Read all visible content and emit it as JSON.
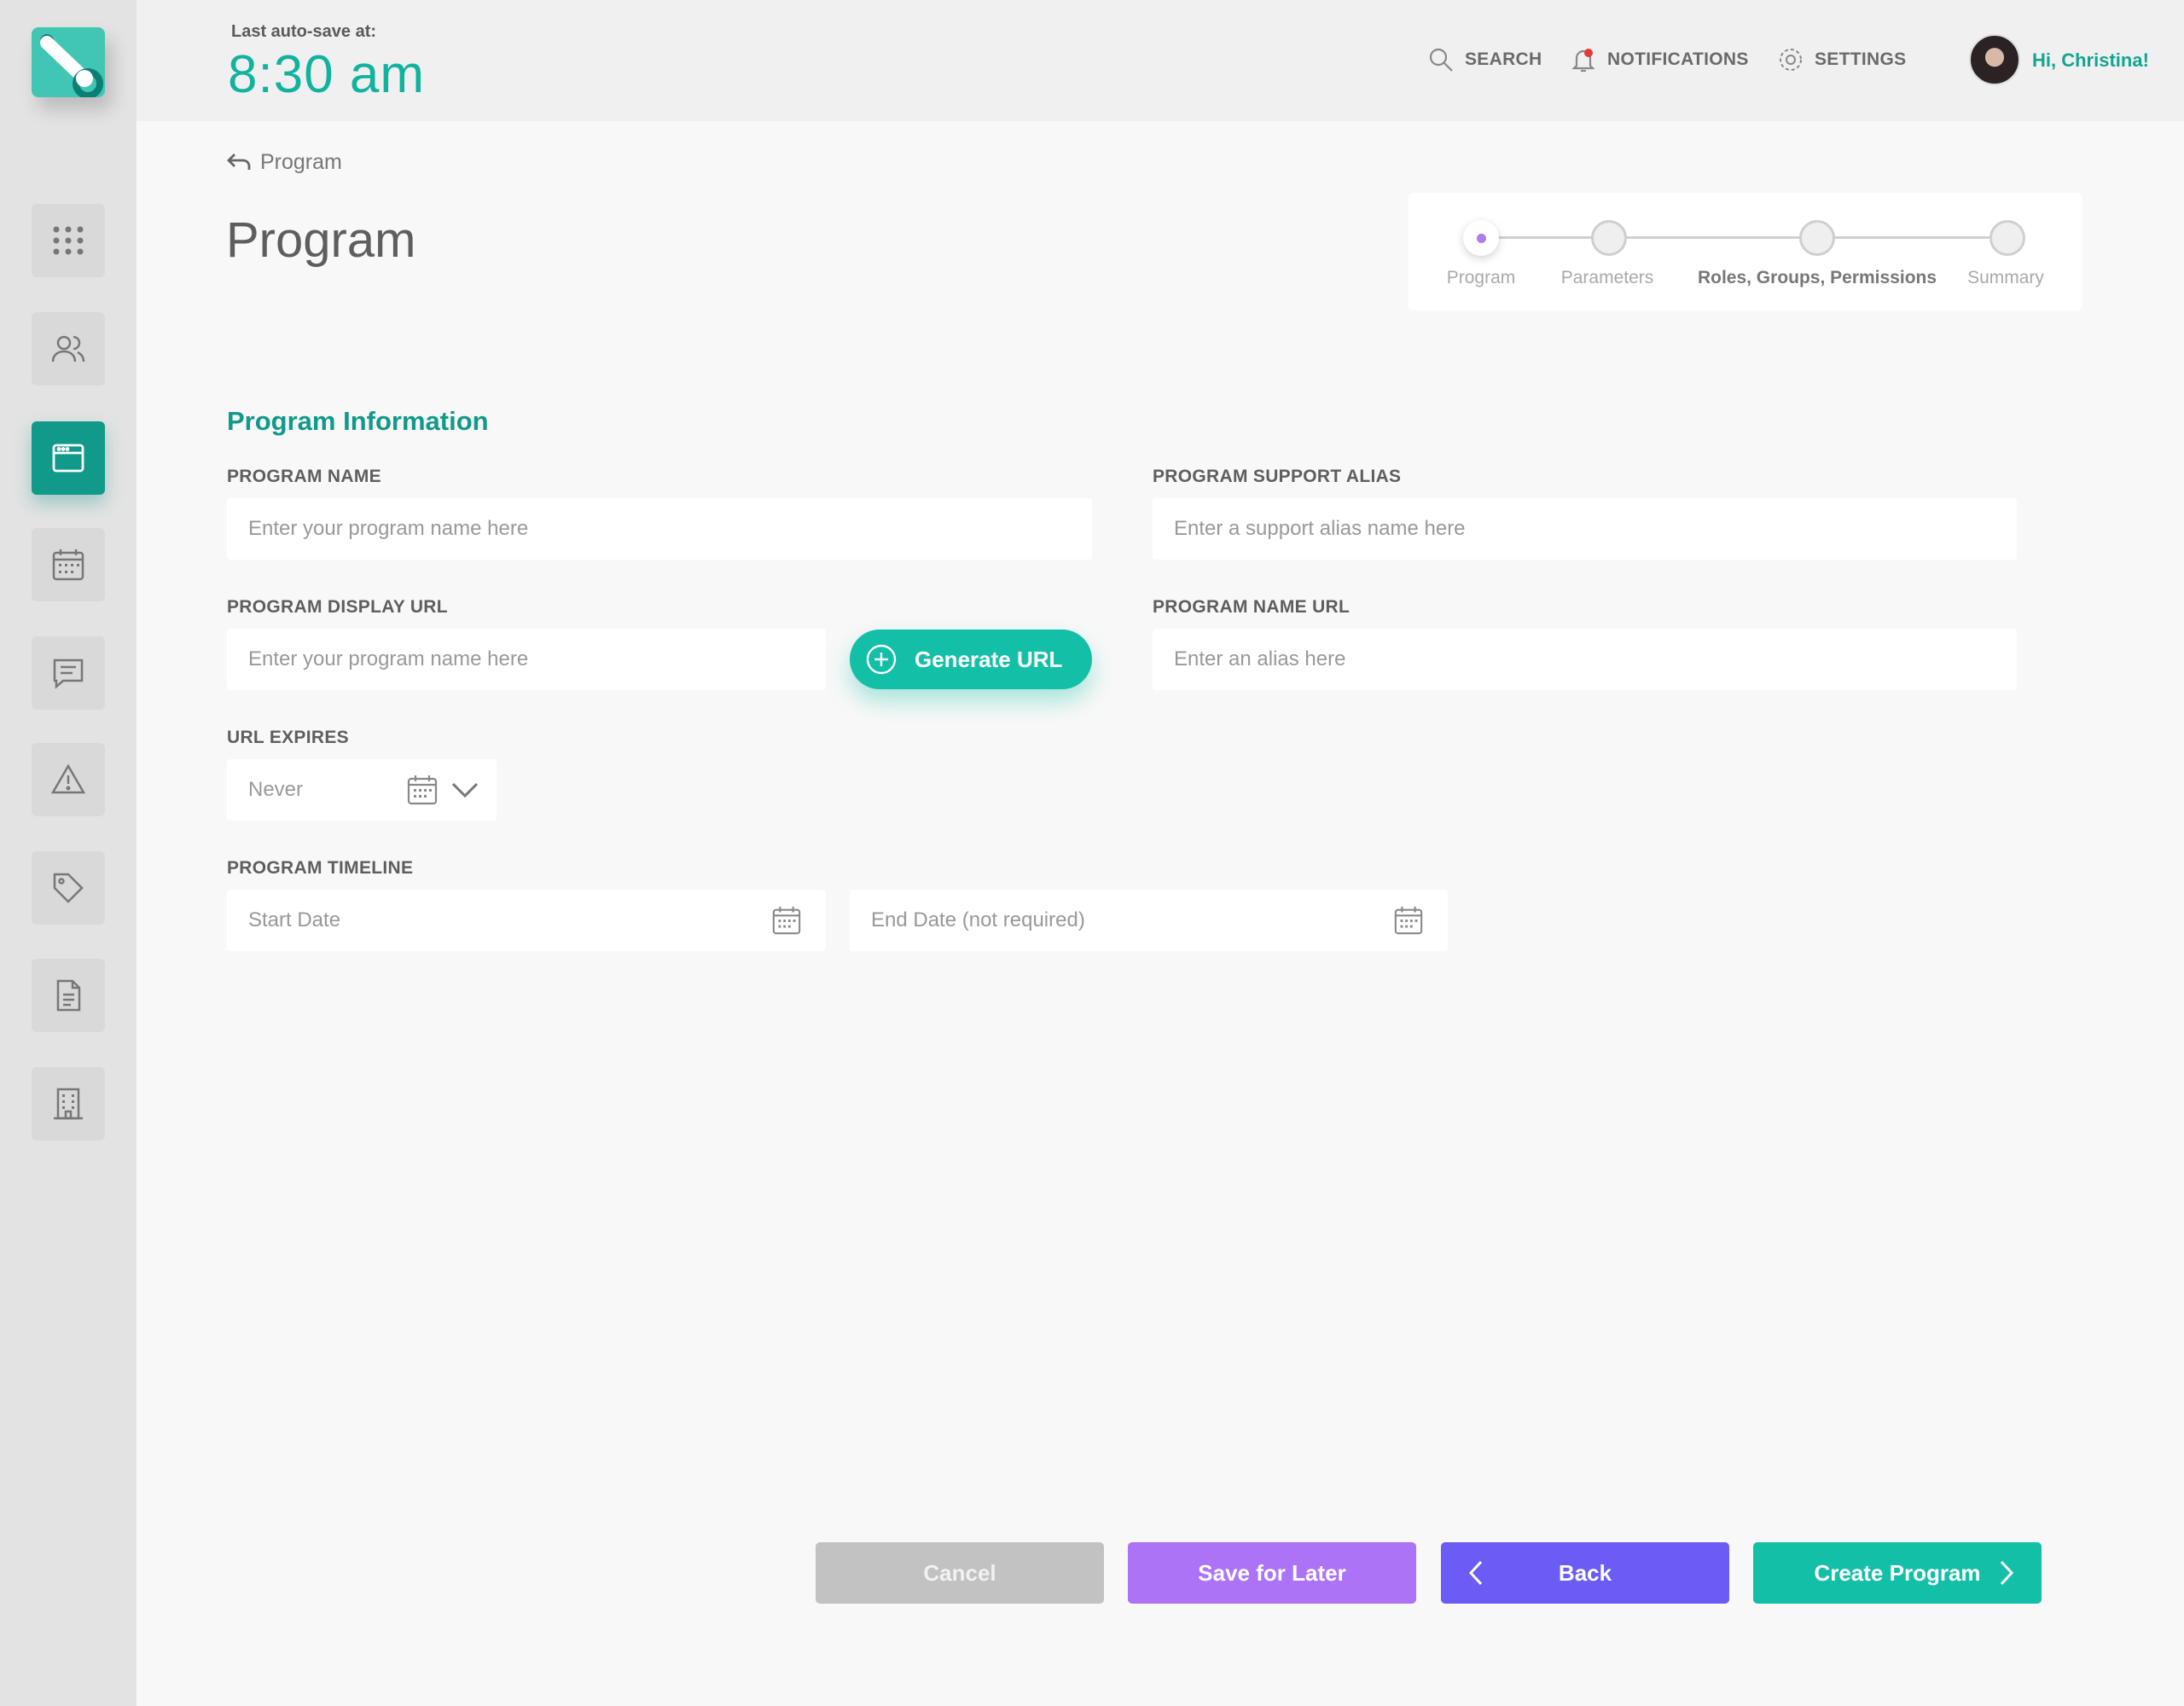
{
  "header": {
    "autosave_label": "Last auto-save at:",
    "autosave_time": "8:30 am",
    "search_label": "SEARCH",
    "notifications_label": "NOTIFICATIONS",
    "settings_label": "SETTINGS",
    "greeting": "Hi, Christina!"
  },
  "sidebar": {
    "items": [
      {
        "name": "apps-grid-icon",
        "active": false
      },
      {
        "name": "users-icon",
        "active": false
      },
      {
        "name": "program-window-icon",
        "active": true
      },
      {
        "name": "calendar-icon",
        "active": false
      },
      {
        "name": "chat-icon",
        "active": false
      },
      {
        "name": "warning-icon",
        "active": false
      },
      {
        "name": "tag-icon",
        "active": false
      },
      {
        "name": "document-icon",
        "active": false
      },
      {
        "name": "building-icon",
        "active": false
      }
    ]
  },
  "breadcrumb": {
    "label": "Program"
  },
  "page": {
    "title": "Program"
  },
  "stepper": {
    "steps": [
      {
        "label": "Program",
        "state": "active"
      },
      {
        "label": "Parameters",
        "state": "pending"
      },
      {
        "label": "Roles, Groups, Permissions",
        "state": "pending"
      },
      {
        "label": "Summary",
        "state": "pending"
      }
    ]
  },
  "form": {
    "section_title": "Program Information",
    "program_name": {
      "label": "PROGRAM NAME",
      "placeholder": "Enter your program name here",
      "value": ""
    },
    "support_alias": {
      "label": "PROGRAM SUPPORT ALIAS",
      "placeholder": "Enter a support alias name here",
      "value": ""
    },
    "display_url": {
      "label": "PROGRAM DISPLAY URL",
      "placeholder": "Enter your program name here",
      "value": ""
    },
    "generate_url_label": "Generate URL",
    "name_url": {
      "label": "PROGRAM NAME URL",
      "placeholder": "Enter an alias here",
      "value": ""
    },
    "url_expires": {
      "label": "URL EXPIRES",
      "value": "Never"
    },
    "timeline": {
      "label": "PROGRAM TIMELINE",
      "start_placeholder": "Start Date",
      "end_placeholder": "End Date (not required)"
    }
  },
  "actions": {
    "cancel": "Cancel",
    "save_later": "Save for Later",
    "back": "Back",
    "create": "Create Program"
  },
  "colors": {
    "accent": "#11998a",
    "teal": "#14bfa8",
    "purple": "#ad73f7",
    "indigo": "#6c5cf6",
    "disabled": "#c2c2c2",
    "notification_dot": "#e53935"
  }
}
